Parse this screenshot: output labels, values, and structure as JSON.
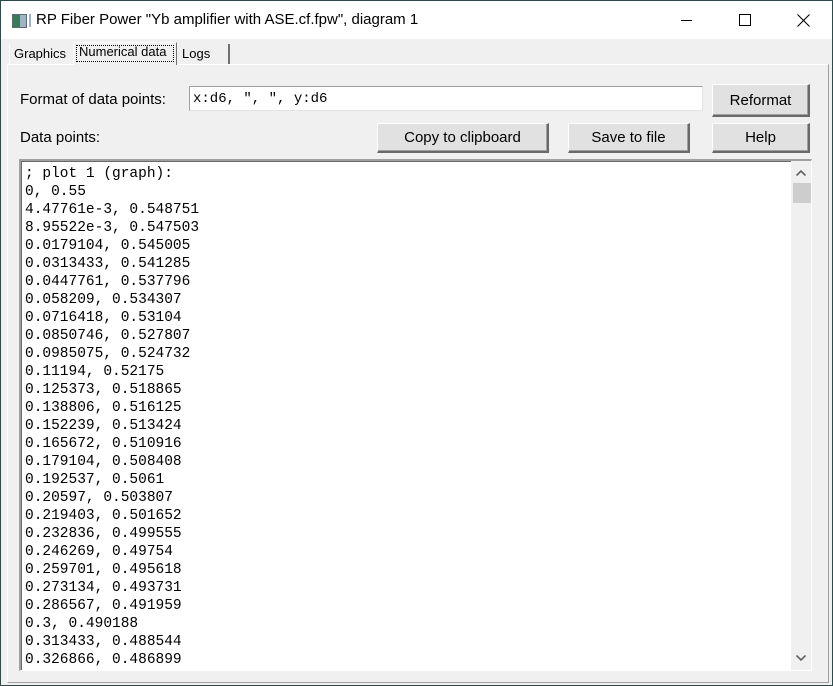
{
  "window": {
    "title": "RP Fiber Power \"Yb amplifier with ASE.cf.fpw\", diagram 1",
    "app_icon": "rp-fiber-power-icon",
    "controls": [
      "minimize",
      "maximize",
      "close"
    ]
  },
  "tabs": [
    {
      "label": "Graphics",
      "active": false
    },
    {
      "label": "Numerical data",
      "active": true
    },
    {
      "label": "Logs",
      "active": false
    }
  ],
  "format": {
    "label": "Format of data points:",
    "value": "x:d6, \", \", y:d6",
    "reformat_label": "Reformat"
  },
  "data_points": {
    "label": "Data points:",
    "copy_label": "Copy to clipboard",
    "save_label": "Save to file",
    "help_label": "Help",
    "lines": [
      "; plot 1 (graph):",
      "0, 0.55",
      "4.47761e-3, 0.548751",
      "8.95522e-3, 0.547503",
      "0.0179104, 0.545005",
      "0.0313433, 0.541285",
      "0.0447761, 0.537796",
      "0.058209, 0.534307",
      "0.0716418, 0.53104",
      "0.0850746, 0.527807",
      "0.0985075, 0.524732",
      "0.11194, 0.52175",
      "0.125373, 0.518865",
      "0.138806, 0.516125",
      "0.152239, 0.513424",
      "0.165672, 0.510916",
      "0.179104, 0.508408",
      "0.192537, 0.5061",
      "0.20597, 0.503807",
      "0.219403, 0.501652",
      "0.232836, 0.499555",
      "0.246269, 0.49754",
      "0.259701, 0.495618",
      "0.273134, 0.493731",
      "0.286567, 0.491959",
      "0.3, 0.490188",
      "0.313433, 0.488544",
      "0.326866, 0.486899"
    ]
  },
  "scrollbar": {
    "position_fraction": 0.0
  }
}
